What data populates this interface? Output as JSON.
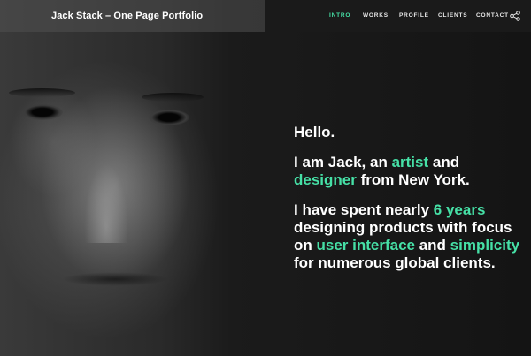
{
  "header": {
    "brand": "Jack Stack – One Page Portfolio",
    "nav": [
      {
        "label": "INTRO",
        "active": true
      },
      {
        "label": "WORKS",
        "active": false
      },
      {
        "label": "PROFILE",
        "active": false
      },
      {
        "label": "CLIENTS",
        "active": false
      },
      {
        "label": "CONTACT",
        "active": false
      }
    ],
    "share_icon": "share-icon"
  },
  "intro": {
    "greeting": "Hello.",
    "line2": {
      "a": "I am Jack, an ",
      "b": "artist",
      "c": " and ",
      "d": "designer",
      "e": " from New York."
    },
    "line3": {
      "a": "I have spent nearly ",
      "b": "6 years",
      "c": " designing products with focus on ",
      "d": "user interface",
      "e": " and ",
      "f": "simplicity",
      "g": " for numerous global clients."
    }
  },
  "colors": {
    "accent": "#46e0a6",
    "text": "#ffffff",
    "background": "#161616"
  }
}
